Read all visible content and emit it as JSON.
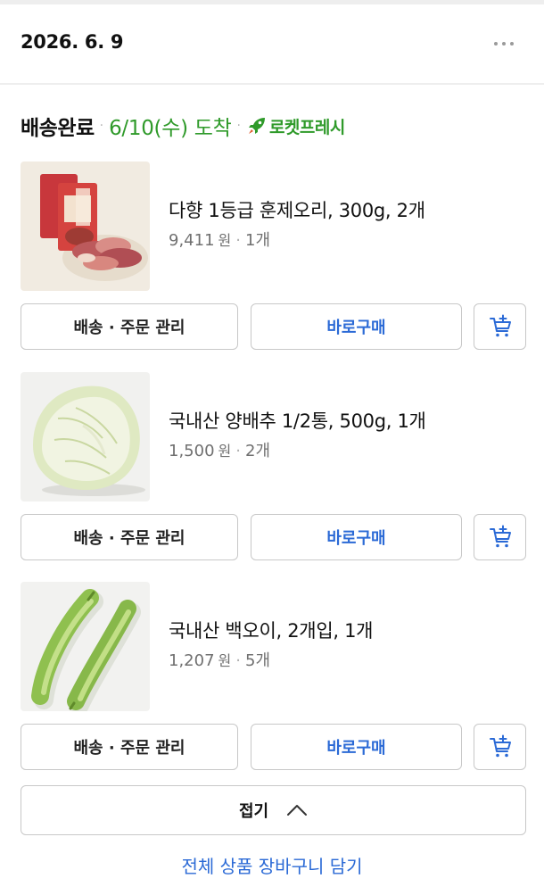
{
  "order": {
    "date": "2026. 6. 9",
    "more_label": "···"
  },
  "shipment": {
    "status": "배송완료",
    "separator": "·",
    "arrival": "6/10(수) 도착",
    "badge_icon": "rocket-icon",
    "badge_label": "로켓프레시",
    "badge_color": "#2f9a2a"
  },
  "items": [
    {
      "title": "다향 1등급 훈제오리, 300g, 2개",
      "price": "9,411",
      "currency": "원",
      "separator": "·",
      "quantity": "1개",
      "image": "smoked-duck-package-image"
    },
    {
      "title": "국내산 양배추 1/2통, 500g, 1개",
      "price": "1,500",
      "currency": "원",
      "separator": "·",
      "quantity": "2개",
      "image": "half-cabbage-image"
    },
    {
      "title": "국내산 백오이, 2개입, 1개",
      "price": "1,207",
      "currency": "원",
      "separator": "·",
      "quantity": "5개",
      "image": "cucumbers-image"
    }
  ],
  "buttons": {
    "manage_label": "배송 · 주문 관리",
    "buy_label": "바로구매",
    "cart_icon": "add-to-cart-icon",
    "fold_label": "접기",
    "fold_icon": "chevron-up-icon",
    "add_all_label": "전체 상품 장바구니 담기"
  },
  "colors": {
    "accent_blue": "#2b6ad6",
    "fresh_green": "#2f9a2a",
    "border": "#c8c8c8"
  }
}
